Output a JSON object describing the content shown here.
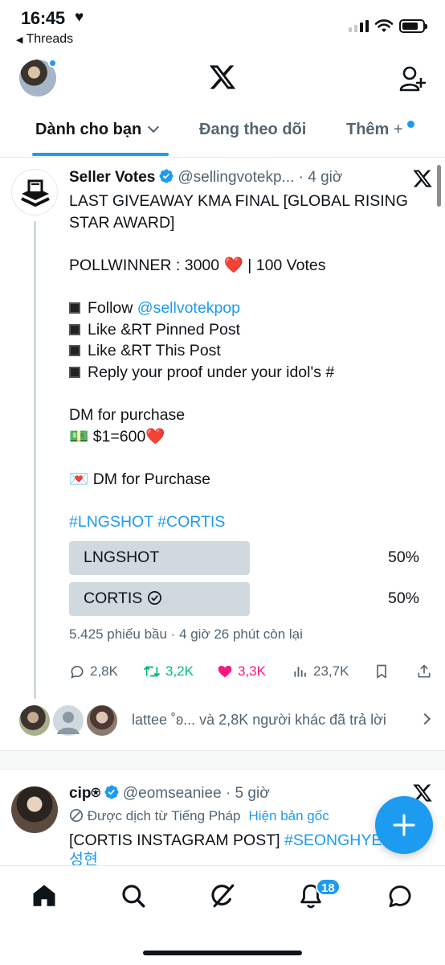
{
  "status_bar": {
    "time": "16:45",
    "back_app": "Threads"
  },
  "colors": {
    "accent": "#1d9bf0",
    "text": "#0f1419",
    "secondary": "#536471",
    "like": "#f91880",
    "retweet": "#00ba7c",
    "poll_fill": "#cfd9de"
  },
  "tabs": [
    {
      "label": "Dành cho bạn",
      "active": true
    },
    {
      "label": "Đang theo dõi",
      "active": false
    },
    {
      "label": "Thêm",
      "active": false
    }
  ],
  "post": {
    "name": "Seller Votes",
    "handle": "@sellingvotekp...",
    "time": "· 4 giờ",
    "lines": {
      "title": "LAST GIVEAWAY KMA FINAL [GLOBAL RISING STAR AWARD]",
      "pollwinner": "POLLWINNER : 3000 ❤️ | 100 Votes",
      "follow_prefix": "Follow ",
      "follow_link": "@sellvotekpop",
      "like_rt_pinned": "Like &RT Pinned Post",
      "like_rt_this": "Like &RT This Post",
      "reply_proof": "Reply your proof under your idol's #",
      "dm_purchase": "DM for purchase",
      "price": "💵 $1=600❤️",
      "dm_purchase2": "💌 DM for Purchase",
      "hashtags": "#LNGSHOT  #CORTIS"
    },
    "poll": {
      "options": [
        {
          "label": "LNGSHOT",
          "percent": "50%",
          "fraction": 0.5,
          "checked": false
        },
        {
          "label": "CORTIS",
          "percent": "50%",
          "fraction": 0.5,
          "checked": true
        }
      ],
      "meta": "5.425 phiếu bầu · 4 giờ 26 phút còn lại"
    },
    "actions": {
      "replies": "2,8K",
      "reposts": "3,2K",
      "likes": "3,3K",
      "views": "23,7K"
    },
    "replies_summary": "lattee ˚ʚ... và 2,8K người khác đã trả lời"
  },
  "post2": {
    "name": "cip⍟",
    "handle": "@eomseaniee",
    "time": "· 5 giờ",
    "translated": "Được dịch từ Tiếng Pháp",
    "show_original": "Hiện bản gốc",
    "text_prefix": "[CORTIS INSTAGRAM POST] ",
    "text_hashtag": "#SEONGHYEON",
    "text_line2": "성현"
  },
  "bottom_nav": {
    "notifications_badge": "18",
    "icons": [
      "home-icon",
      "search-icon",
      "grok-icon",
      "notifications-icon",
      "messages-icon"
    ]
  }
}
